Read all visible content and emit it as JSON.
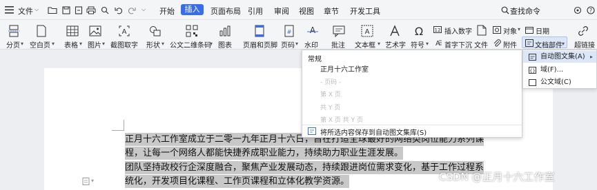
{
  "menubar": {
    "file_label": "文件",
    "tabs": [
      "开始",
      "插入",
      "页面布局",
      "引用",
      "审阅",
      "视图",
      "章节",
      "开发工具"
    ],
    "active_tab": "插入",
    "search_label": "查找命令"
  },
  "ribbon": {
    "buttons": [
      "分页",
      "空白页",
      "表格",
      "图片",
      "截图取字",
      "形状",
      "公文二维条码",
      "图表",
      "页眉和页脚",
      "页码",
      "水印",
      "批注",
      "文本框",
      "艺术字",
      "符号"
    ],
    "small_buttons": {
      "insert_number": "插入数字",
      "drop_cap": "首字下沉",
      "file": "文件",
      "attachment": "附件",
      "object": "对象",
      "date": "日期",
      "doc_parts": "文档部件",
      "hyperlink": "超链接"
    }
  },
  "dropdown": {
    "section_title": "常规",
    "items": [
      "正月十六工作室",
      "- 页码 -",
      "第 X 页",
      "共 Y 页",
      "第 X 页 共 Y 页"
    ],
    "save_label": "将所选内容保存到自动图文集库(S)"
  },
  "submenu": {
    "items": [
      "自动图文集(A)",
      "域(F)...",
      "公文域(C)"
    ]
  },
  "document": {
    "lines": [
      "正月十六工作室成立于二零一九年正月十六日，旨在打造全球最好的网络类岗位能力系列课",
      "程，让每一个网络人都能快捷养成职业能力，持续助力职业生涯发展。",
      "团队坚持政校行企深度融合，聚焦产业发展动态，持续跟进岗位需求变化，基于工作过程系",
      "统化，开发项目化课程、工作页课程和立体化教学资源。"
    ]
  },
  "watermark": "CSDN @正月十六工作室",
  "colors": {
    "accent": "#3a6ee8",
    "selection": "#c8c8c8",
    "highlight": "#dbe6f9"
  }
}
